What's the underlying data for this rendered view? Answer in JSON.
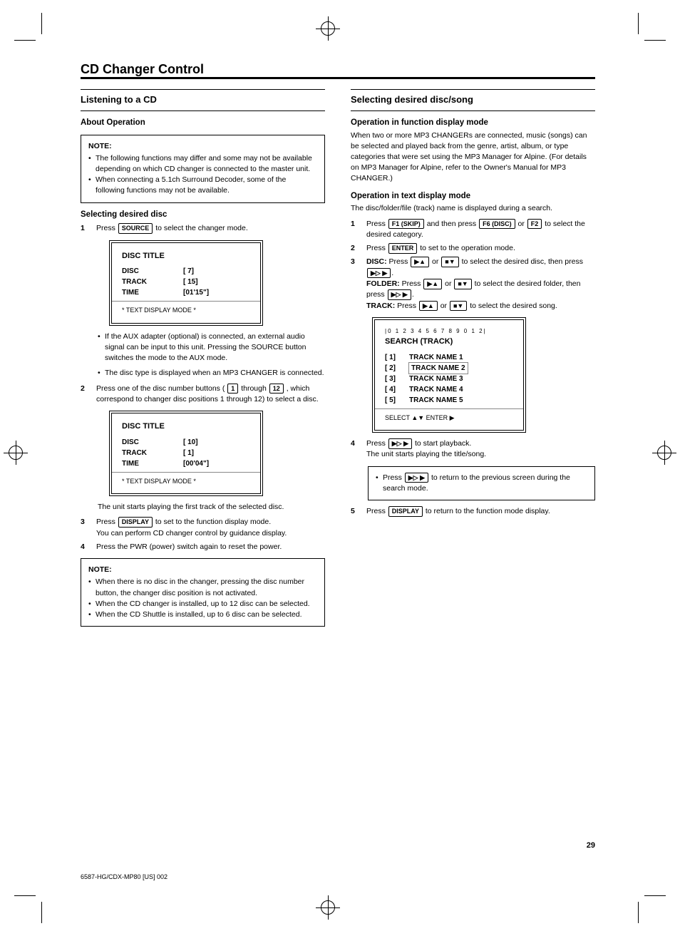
{
  "page_number": "29",
  "spine": "6587-HG/CDX-MP80 [US] 002",
  "title": "CD Changer Control",
  "left": {
    "section_title": "Listening to a CD",
    "note1_label": "NOTE:",
    "note1_lines": [
      "The following functions may differ and some may not be available depending on which CD changer is connected to the master unit.",
      "When connecting a 5.1ch Surround Decoder, some of the following functions may not be available."
    ],
    "step1_num": "1",
    "step1_text": "Press ",
    "step1_key": "SOURCE",
    "step1_text2": " to select the changer mode.",
    "screen1": {
      "title": "DISC TITLE",
      "rows": [
        [
          "DISC",
          "[      7]"
        ],
        [
          "TRACK",
          "[    15]"
        ],
        [
          "TIME",
          "[01'15\"]"
        ]
      ],
      "textmode": "* TEXT DISPLAY MODE *"
    },
    "aux_expl": "If the AUX adapter (optional) is connected, an external audio signal can be input to this unit. Pressing the SOURCE button switches the mode to the AUX mode.",
    "disc_type_lead": "The disc type is displayed when an MP3 CHANGER is connected.",
    "step2_num": "2",
    "step2_text_a": "Press one of the disc number buttons (",
    "step2_key": "1",
    "step2_text_b": " through ",
    "step2_text_c": ", which correspond to changer disc positions 1 through 12) to select a disc.",
    "screen2": {
      "title": "DISC TITLE",
      "rows": [
        [
          "DISC",
          "[    10]"
        ],
        [
          "TRACK",
          "[      1]"
        ],
        [
          "TIME",
          "[00'04\"]"
        ]
      ],
      "textmode": "* TEXT DISPLAY MODE *"
    },
    "step2_sub": "The unit starts playing the first track of the selected disc.",
    "step3_num": "3",
    "step3_text_a": "Press ",
    "step3_key": "DISPLAY",
    "step3_text_b": " to set to the function display mode.",
    "step3_sub": "You can perform CD changer control by guidance display.",
    "step4_num": "4",
    "step4_text": "Press the PWR (power) switch again to reset the power.",
    "note2_label": "NOTE:",
    "note2_lines": [
      "When there is no disc in the changer, pressing the disc number button, the changer disc position is not activated.",
      "When the CD changer is installed, up to 12 disc can be selected.",
      "When the CD Shuttle is installed, up to 6 disc can be selected."
    ]
  },
  "right": {
    "section_title": "Selecting desired disc/song",
    "h_func": "Operation in function display mode",
    "h_text": "Operation in text display mode",
    "step1_num": "1",
    "step1_a": "Press ",
    "k_f1": "F1 (SKIP)",
    "step1_b": " and then press ",
    "k_f6": "F6 (DISC)",
    "step1_c": " or ",
    "k_f2": "F2",
    "step1_d": " to select the desired category.",
    "step2_num": "2",
    "step2_a": "Press ",
    "k_enter": "ENTER",
    "step2_b": " to set to the operation mode.",
    "step3_num": "3",
    "step3_disc": "DISC: ",
    "step3_disc_txt": "Press ",
    "k_up": "▶▲",
    "step3_or": " or ",
    "k_dn": "■▼",
    "step3_disc_tail": " to select the desired disc, then press ",
    "k_play": "▶▷ ▶",
    "step3_folder": "FOLDER: ",
    "step3_folder_txt": "Press ",
    "step3_folder_tail": " to select the desired folder, then press ",
    "step3_track": "TRACK: ",
    "step3_track_tail": " to select the desired song.",
    "screen3": {
      "bar": "|0  1  2  3  4  5  6  7  8  9  0  1  2|",
      "title": "SEARCH (TRACK)",
      "rows": [
        [
          "[  1]",
          "TRACK NAME 1"
        ],
        [
          "[  2]",
          "TRACK NAME 2"
        ],
        [
          "[  3]",
          "TRACK NAME 3"
        ],
        [
          "[  4]",
          "TRACK NAME 4"
        ],
        [
          "[  5]",
          "TRACK NAME 5"
        ]
      ],
      "foot": "SELECT  ▲▼   ENTER  ▶"
    },
    "step4_num": "4",
    "step4_text_a": "Press ",
    "step4_text_b": " to start playback.",
    "after4": "The unit starts playing the title/song.",
    "notebox_lines": [
      "Press ▶▷ ▶ to return to the previous screen during the search mode."
    ],
    "step5_num": "5",
    "step5_text_a": "Press ",
    "k_display": "DISPLAY",
    "step5_text_b": " to return to the function mode display."
  }
}
